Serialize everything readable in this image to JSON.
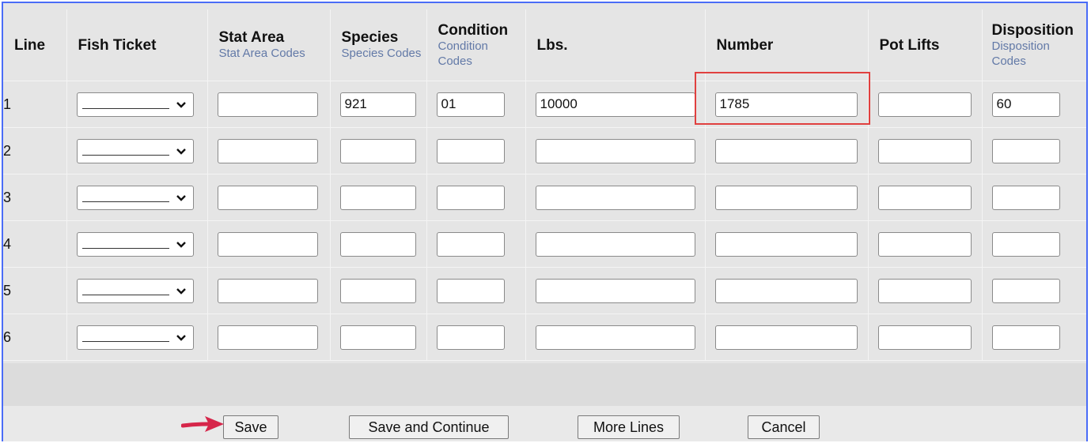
{
  "columns": [
    {
      "title": "Line",
      "sub": ""
    },
    {
      "title": "Fish Ticket",
      "sub": ""
    },
    {
      "title": "Stat Area",
      "sub": "Stat Area Codes"
    },
    {
      "title": "Species",
      "sub": "Species Codes"
    },
    {
      "title": "Condition",
      "sub": "Condition Codes"
    },
    {
      "title": "Lbs.",
      "sub": ""
    },
    {
      "title": "Number",
      "sub": ""
    },
    {
      "title": "Pot Lifts",
      "sub": ""
    },
    {
      "title": "Disposition",
      "sub": "Disposition Codes"
    }
  ],
  "rows": [
    {
      "line": "1",
      "fish_ticket": "",
      "stat_area": "",
      "species": "921",
      "condition": "01",
      "lbs": "10000",
      "number": "1785",
      "pot_lifts": "",
      "disposition": "60"
    },
    {
      "line": "2",
      "fish_ticket": "",
      "stat_area": "",
      "species": "",
      "condition": "",
      "lbs": "",
      "number": "",
      "pot_lifts": "",
      "disposition": ""
    },
    {
      "line": "3",
      "fish_ticket": "",
      "stat_area": "",
      "species": "",
      "condition": "",
      "lbs": "",
      "number": "",
      "pot_lifts": "",
      "disposition": ""
    },
    {
      "line": "4",
      "fish_ticket": "",
      "stat_area": "",
      "species": "",
      "condition": "",
      "lbs": "",
      "number": "",
      "pot_lifts": "",
      "disposition": ""
    },
    {
      "line": "5",
      "fish_ticket": "",
      "stat_area": "",
      "species": "",
      "condition": "",
      "lbs": "",
      "number": "",
      "pot_lifts": "",
      "disposition": ""
    },
    {
      "line": "6",
      "fish_ticket": "",
      "stat_area": "",
      "species": "",
      "condition": "",
      "lbs": "",
      "number": "",
      "pot_lifts": "",
      "disposition": ""
    }
  ],
  "buttons": {
    "save": "Save",
    "save_continue": "Save and Continue",
    "more_lines": "More Lines",
    "cancel": "Cancel"
  },
  "icons": {
    "dropdown": "chevron-down-icon",
    "pointer": "arrow-pointer-icon"
  },
  "colors": {
    "frame_border": "#4a6cf7",
    "highlight_border": "#e0403f",
    "code_link": "#6279a7",
    "arrow": "#d6264a"
  }
}
